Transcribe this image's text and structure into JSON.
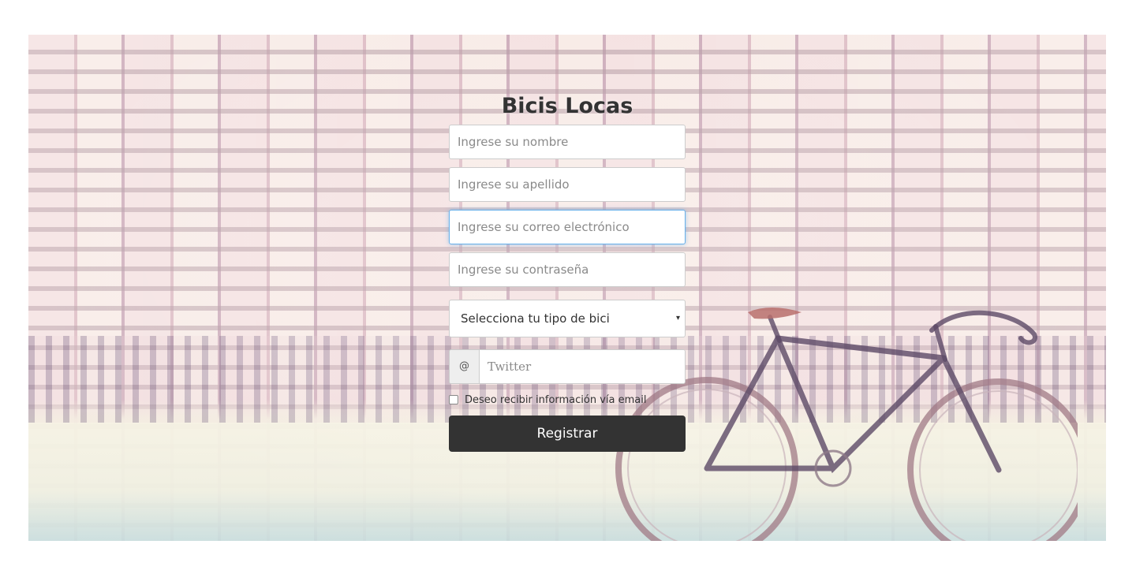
{
  "app": {
    "title": "Bicis Locas"
  },
  "form": {
    "name_placeholder": "Ingrese su nombre",
    "lastname_placeholder": "Ingrese su apellido",
    "email_placeholder": "Ingrese su correo electrónico",
    "password_placeholder": "Ingrese su contraseña",
    "bike_type": {
      "selected": "Selecciona tu tipo de bici",
      "caret": "▾"
    },
    "twitter": {
      "addon": "@",
      "placeholder": "Twitter"
    },
    "newsletter": {
      "label": "Deseo recibir información vía email",
      "checked": false
    },
    "submit_label": "Registrar"
  },
  "colors": {
    "button_background": "#333333",
    "button_text": "#ffffff",
    "focus_border": "#66afe9",
    "title_text": "#333333"
  },
  "background": {
    "image_subject": "brick wall with bicycle"
  }
}
